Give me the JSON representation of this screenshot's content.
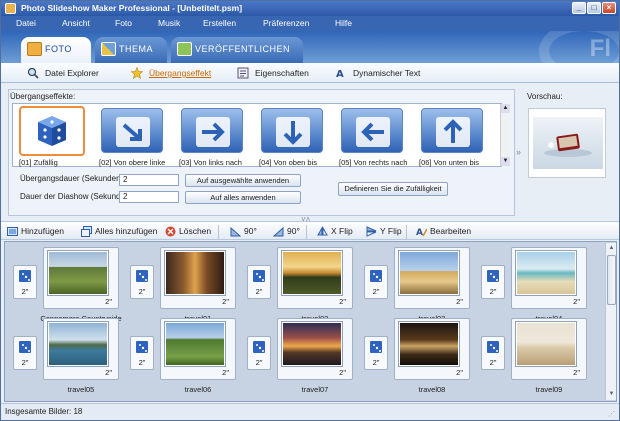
{
  "window": {
    "title": "Photo Slideshow Maker Professional - [Unbetitelt.psm]",
    "controls": [
      "_",
      "□",
      "×"
    ]
  },
  "menu": [
    "Datei",
    "Ansicht",
    "Foto",
    "Musik",
    "Erstellen",
    "Präferenzen",
    "Hilfe"
  ],
  "main_tabs": [
    {
      "label": "FOTO",
      "active": true
    },
    {
      "label": "THEMA",
      "active": false
    },
    {
      "label": "VERÖFFENTLICHEN",
      "active": false
    }
  ],
  "tab_band_deco": "Fl",
  "sub_tabs": [
    {
      "label": "Datei Explorer",
      "active": false
    },
    {
      "label": "Übergangseffekt",
      "active": true
    },
    {
      "label": "Eigenschaften",
      "active": false
    },
    {
      "label": "Dynamischer Text",
      "active": false
    }
  ],
  "effects": {
    "label": "Übergangseffekte:",
    "items": [
      {
        "caption": "[01] Zufällig",
        "icon": "dice-icon",
        "selected": true
      },
      {
        "caption": "[02] Von obere linke",
        "icon": "arrow-down-right-icon",
        "selected": false
      },
      {
        "caption": "[03] Von links nach",
        "icon": "arrow-right-icon",
        "selected": false
      },
      {
        "caption": "[04] Von oben bis",
        "icon": "arrow-down-icon",
        "selected": false
      },
      {
        "caption": "[05] Von rechts nach",
        "icon": "arrow-left-icon",
        "selected": false
      },
      {
        "caption": "[06] Von unten bis",
        "icon": "arrow-up-icon",
        "selected": false
      }
    ],
    "scroll_up": "▲",
    "scroll_down": "▼",
    "transition_duration_label": "Übergangsdauer (Sekunden):",
    "transition_duration_value": "2",
    "apply_selected_button": "Auf ausgewählte anwenden",
    "slideshow_duration_label": "Dauer der Diashow (Sekunden):",
    "slideshow_duration_value": "2",
    "apply_all_button": "Auf alles anwenden",
    "randomness_button": "Definieren Sie die Zufälligkeit"
  },
  "preview": {
    "label": "Vorschau:"
  },
  "splitter": {
    "expand_glyph": "»",
    "dots": "˅˄"
  },
  "toolbar": {
    "add": "Hinzufügen",
    "add_all": "Alles hinzufügen",
    "delete": "Löschen",
    "rotate_left": "90°",
    "rotate_right": "90°",
    "x_flip": "X Flip",
    "y_flip": "Y Flip",
    "edit": "Bearbeiten"
  },
  "filmstrip": {
    "scroll_up": "▲",
    "scroll_down": "▼",
    "row1": [
      {
        "name": "Connemora Countryside",
        "duration": "2\"",
        "transition": "2\"",
        "scene": "countryside"
      },
      {
        "name": "travel01",
        "duration": "2\"",
        "transition": "2\"",
        "scene": "street"
      },
      {
        "name": "travel02",
        "duration": "2\"",
        "transition": "2\"",
        "scene": "sunset"
      },
      {
        "name": "travel03",
        "duration": "2\"",
        "transition": "2\"",
        "scene": "dome"
      },
      {
        "name": "travel04",
        "duration": "2\"",
        "transition": "2\"",
        "scene": "beach"
      }
    ],
    "row2": [
      {
        "name": "travel05",
        "duration": "2\"",
        "transition": "2\"",
        "scene": "boats"
      },
      {
        "name": "travel06",
        "duration": "2\"",
        "transition": "2\"",
        "scene": "alpine"
      },
      {
        "name": "travel07",
        "duration": "2\"",
        "transition": "2\"",
        "scene": "lighthouse"
      },
      {
        "name": "travel08",
        "duration": "2\"",
        "transition": "2\"",
        "scene": "dusk"
      },
      {
        "name": "travel09",
        "duration": "2\"",
        "transition": "2\"",
        "scene": "desert"
      }
    ]
  },
  "status": {
    "text": "Insgesamte Bilder: 18",
    "grip": "⋰"
  },
  "colors": {
    "accent": "#f08a3c",
    "brand_blue": "#2e62b5",
    "titlebar": "#3866b3"
  }
}
